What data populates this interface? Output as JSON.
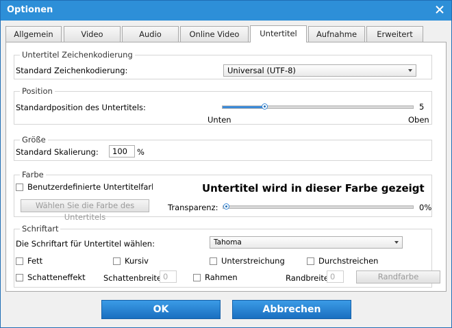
{
  "window": {
    "title": "Optionen"
  },
  "tabs": [
    {
      "label": "Allgemein"
    },
    {
      "label": "Video"
    },
    {
      "label": "Audio"
    },
    {
      "label": "Online Video"
    },
    {
      "label": "Untertitel",
      "active": true
    },
    {
      "label": "Aufnahme"
    },
    {
      "label": "Erweitert"
    }
  ],
  "encoding": {
    "legend": "Untertitel Zeichenkodierung",
    "label": "Standard Zeichenkodierung:",
    "value": "Universal (UTF-8)"
  },
  "position": {
    "legend": "Position",
    "label": "Standardposition des Untertitels:",
    "value": "5",
    "level_fraction": 0.22,
    "min_label": "Unten",
    "max_label": "Oben"
  },
  "size": {
    "legend": "Größe",
    "label": "Standard Skalierung:",
    "value": "100",
    "unit": "%"
  },
  "color": {
    "legend": "Farbe",
    "custom_label": "Benutzerdefinierte Untertitelfarben ve",
    "choose_button": "Wählen Sie die Farbe des Untertitels",
    "preview": "Untertitel wird in dieser Farbe gezeigt",
    "transparency_label": "Transparenz:",
    "transparency_value": "0%",
    "transparency_fraction": 0.0
  },
  "font": {
    "legend": "Schriftart",
    "label": "Die Schriftart für Untertitel wählen:",
    "value": "Tahoma",
    "bold": "Fett",
    "italic": "Kursiv",
    "underline": "Unterstreichung",
    "strike": "Durchstreichen",
    "shadow": "Schatteneffekt",
    "shadow_width_label": "Schattenbreite:",
    "shadow_width_value": "0",
    "frame": "Rahmen",
    "frame_width_label": "Randbreite:",
    "frame_width_value": "0",
    "frame_color_button": "Randfarbe"
  },
  "buttons": {
    "ok": "OK",
    "cancel": "Abbrechen"
  },
  "colors": {
    "titlebar": "#2d8fd8",
    "accent": "#1f6db5"
  }
}
